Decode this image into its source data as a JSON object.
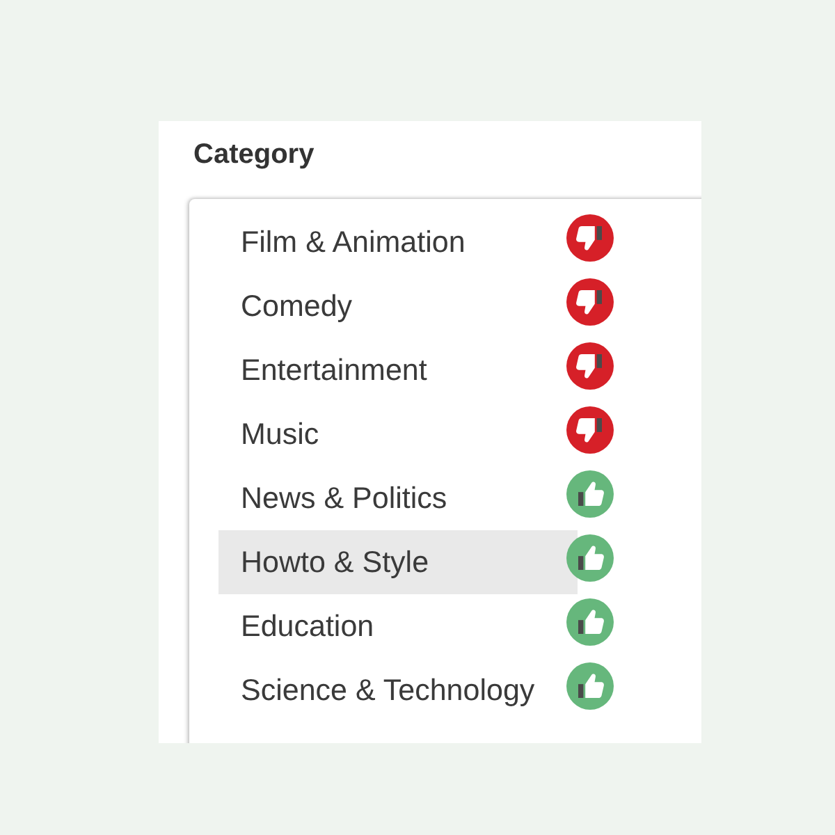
{
  "heading": "Category",
  "options": [
    {
      "label": "Film & Animation",
      "kind": "down",
      "selected": false
    },
    {
      "label": "Comedy",
      "kind": "down",
      "selected": false
    },
    {
      "label": "Entertainment",
      "kind": "down",
      "selected": false
    },
    {
      "label": "Music",
      "kind": "down",
      "selected": false
    },
    {
      "label": "News & Politics",
      "kind": "up",
      "selected": false
    },
    {
      "label": "Howto & Style",
      "kind": "up",
      "selected": true
    },
    {
      "label": "Education",
      "kind": "up",
      "selected": false
    },
    {
      "label": "Science & Technology",
      "kind": "up",
      "selected": false
    }
  ]
}
